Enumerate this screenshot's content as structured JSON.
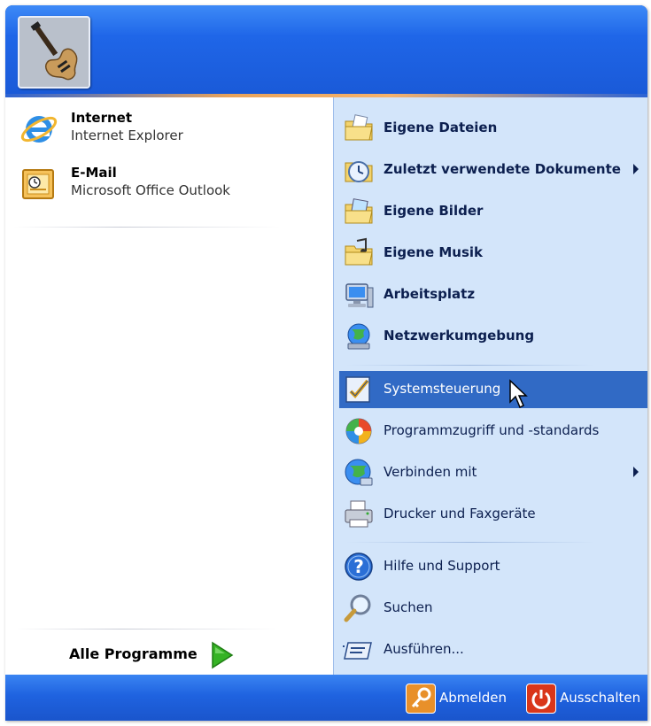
{
  "pinned": [
    {
      "title": "Internet",
      "subtitle": "Internet Explorer",
      "icon": "internet-explorer-icon"
    },
    {
      "title": "E-Mail",
      "subtitle": "Microsoft Office Outlook",
      "icon": "outlook-icon"
    }
  ],
  "all_programs": {
    "label": "Alle Programme",
    "icon": "green-arrow-icon"
  },
  "places": [
    {
      "label": "Eigene Dateien",
      "icon": "my-documents-icon"
    },
    {
      "label": "Zuletzt verwendete Dokumente",
      "icon": "recent-documents-icon"
    },
    {
      "label": "Eigene Bilder",
      "icon": "my-pictures-icon"
    },
    {
      "label": "Eigene Musik",
      "icon": "my-music-icon"
    },
    {
      "label": "Arbeitsplatz",
      "icon": "my-computer-icon"
    },
    {
      "label": "Netzwerkumgebung",
      "icon": "network-places-icon"
    }
  ],
  "settings": [
    {
      "label": "Systemsteuerung",
      "icon": "control-panel-icon",
      "highlighted": true
    },
    {
      "label": "Programmzugriff und -standards",
      "icon": "program-access-icon"
    },
    {
      "label": "Verbinden mit",
      "icon": "connect-to-icon"
    },
    {
      "label": "Drucker und Faxgeräte",
      "icon": "printers-icon"
    }
  ],
  "help": [
    {
      "label": "Hilfe und Support",
      "icon": "help-icon"
    },
    {
      "label": "Suchen",
      "icon": "search-icon"
    },
    {
      "label": "Ausführen...",
      "icon": "run-icon"
    }
  ],
  "footer": {
    "logoff_label": "Abmelden",
    "shutdown_label": "Ausschalten"
  },
  "colors": {
    "header_blue": "#1f66e8",
    "right_pane": "#d3e5fa",
    "highlight": "#316ac5",
    "logoff_orange": "#e8902a",
    "shutdown_red": "#d9361a"
  }
}
